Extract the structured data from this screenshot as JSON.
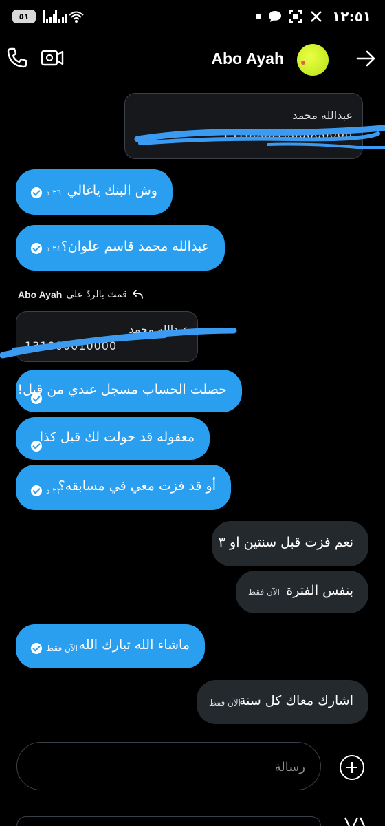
{
  "status_bar": {
    "battery": "٥١",
    "time": "١٢:٥١",
    "wifi_label": "5",
    "icons": [
      "battery-icon",
      "signal-icon",
      "signal-icon",
      "wifi-icon",
      "dot-icon",
      "chat-bubble-icon",
      "screenshot-icon",
      "x-logo-icon"
    ]
  },
  "header": {
    "name": "Abo Ayah",
    "icons": [
      "phone-icon",
      "video-icon",
      "avatar",
      "back-arrow-icon"
    ]
  },
  "colors": {
    "blue_bubble": "#2a9ff0",
    "gray_bubble": "#24292e",
    "background": "#000000",
    "avatar": "#cdf02a",
    "scribble": "#3b9bf2"
  },
  "messages": {
    "top_card": {
      "name": "عبدالله محمد",
      "number": "13100001000000000"
    },
    "m1": {
      "text": "وش البنك ياغالي",
      "time": "٢٦ د"
    },
    "m2": {
      "text": "عبدالله محمد قاسم علوان؟",
      "time": "٢٤ د"
    },
    "reply_label": {
      "prefix": "قمتَ بالردّ على",
      "name": "Abo Ayah"
    },
    "quoted_card": {
      "name": "عبدالله محمد",
      "number": "131000010000"
    },
    "m3": {
      "text": "حصلت الحساب مسجل عندي من قبل!"
    },
    "m4": {
      "text": "معقوله قد حولت لك قبل كذا"
    },
    "m5": {
      "text": "أو قد فزت معي في مسابقه؟",
      "time": "٢٢ د"
    },
    "r1": {
      "text": "نعم فزت قبل سنتين او ٣"
    },
    "r2": {
      "text": "بنفس الفترة",
      "time": "الآن فقط"
    },
    "m6": {
      "text": "ماشاء الله تبارك الله",
      "time": "الآن فقط"
    },
    "r3": {
      "text": "اشارك معاك كل سنة",
      "time": "الآن فقط"
    }
  },
  "composer": {
    "placeholder": "رسالة"
  }
}
